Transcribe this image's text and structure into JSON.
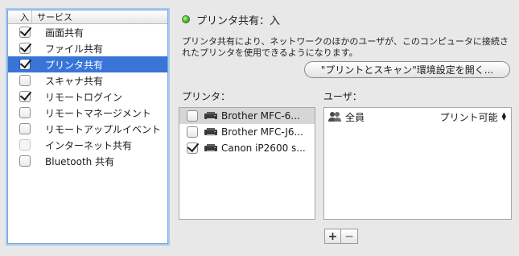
{
  "services": {
    "header_on": "入",
    "header_service": "サービス",
    "items": [
      {
        "label": "画面共有",
        "checked": true,
        "selected": false,
        "disabled": false
      },
      {
        "label": "ファイル共有",
        "checked": true,
        "selected": false,
        "disabled": false
      },
      {
        "label": "プリンタ共有",
        "checked": true,
        "selected": true,
        "disabled": false
      },
      {
        "label": "スキャナ共有",
        "checked": false,
        "selected": false,
        "disabled": false
      },
      {
        "label": "リモートログイン",
        "checked": true,
        "selected": false,
        "disabled": false
      },
      {
        "label": "リモートマネージメント",
        "checked": false,
        "selected": false,
        "disabled": false
      },
      {
        "label": "リモートアップルイベント",
        "checked": false,
        "selected": false,
        "disabled": false
      },
      {
        "label": "インターネット共有",
        "checked": false,
        "selected": false,
        "disabled": true
      },
      {
        "label": "Bluetooth 共有",
        "checked": false,
        "selected": false,
        "disabled": false
      }
    ]
  },
  "detail": {
    "status": "プリンタ共有：入",
    "status_color": "#3ca21c",
    "description": "プリンタ共有により、ネットワークのほかのユーザが、このコンピュータに接続されたプリンタを使用できるようになります。",
    "open_prefs_button": "\"プリントとスキャン\"環境設定を開く...",
    "printers_label": "プリンタ：",
    "users_label": "ユーザ："
  },
  "printers": [
    {
      "name": "Brother MFC-6...",
      "checked": false,
      "selected": true
    },
    {
      "name": "Brother MFC-J6...",
      "checked": false,
      "selected": false
    },
    {
      "name": "Canon iP2600 s...",
      "checked": true,
      "selected": false
    }
  ],
  "users": [
    {
      "name": "全員",
      "permission": "プリント可能",
      "icon": "group-icon"
    }
  ],
  "buttons": {
    "add": "+",
    "remove": "−"
  },
  "colors": {
    "selection": "#3875d7",
    "focus_ring": "#7da7d9"
  }
}
